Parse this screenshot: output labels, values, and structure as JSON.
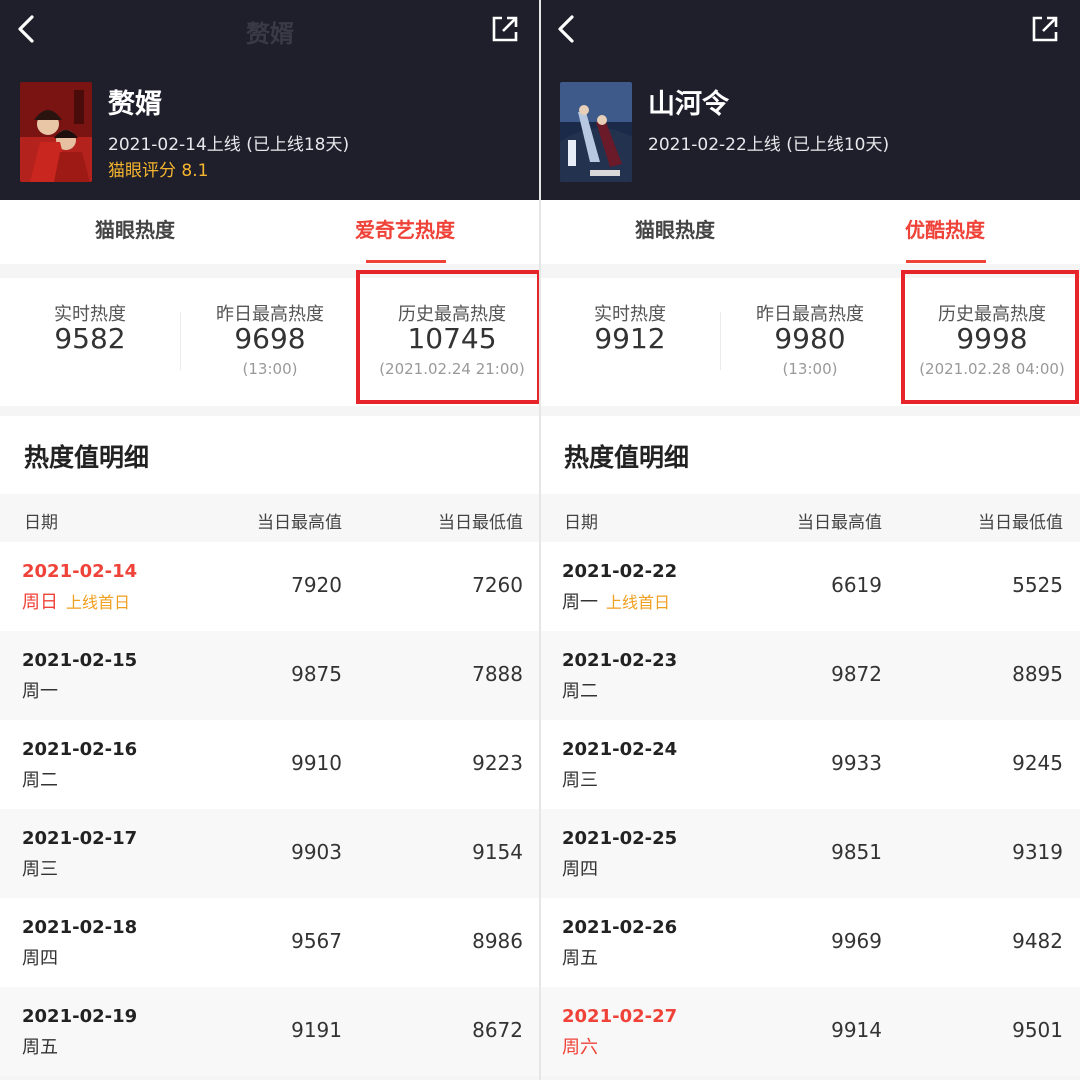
{
  "panels": [
    {
      "nav_title": "赘婿",
      "title": "赘婿",
      "release": "2021-02-14上线 (已上线18天)",
      "rating": "猫眼评分 8.1",
      "poster_icon": "poster-image",
      "tabs": [
        "猫眼热度",
        "爱奇艺热度"
      ],
      "active_tab": 1,
      "stats": {
        "realtime_label": "实时热度",
        "realtime_value": "9582",
        "yesterday_label": "昨日最高热度",
        "yesterday_value": "9698",
        "yesterday_time": "(13:00)",
        "history_label": "历史最高热度",
        "history_value": "10745",
        "history_time": "(2021.02.24 21:00)"
      },
      "section_title": "热度值明细",
      "columns": [
        "日期",
        "当日最高值",
        "当日最低值"
      ],
      "rows": [
        {
          "date": "2021-02-14",
          "weekday": "周日",
          "badge": "上线首日",
          "high": "7920",
          "low": "7260"
        },
        {
          "date": "2021-02-15",
          "weekday": "周一",
          "badge": "",
          "high": "9875",
          "low": "7888"
        },
        {
          "date": "2021-02-16",
          "weekday": "周二",
          "badge": "",
          "high": "9910",
          "low": "9223"
        },
        {
          "date": "2021-02-17",
          "weekday": "周三",
          "badge": "",
          "high": "9903",
          "low": "9154"
        },
        {
          "date": "2021-02-18",
          "weekday": "周四",
          "badge": "",
          "high": "9567",
          "low": "8986"
        },
        {
          "date": "2021-02-19",
          "weekday": "周五",
          "badge": "",
          "high": "9191",
          "low": "8672"
        }
      ]
    },
    {
      "nav_title": "",
      "title": "山河令",
      "release": "2021-02-22上线 (已上线10天)",
      "rating": "",
      "poster_icon": "poster-image",
      "tabs": [
        "猫眼热度",
        "优酷热度"
      ],
      "active_tab": 1,
      "stats": {
        "realtime_label": "实时热度",
        "realtime_value": "9912",
        "yesterday_label": "昨日最高热度",
        "yesterday_value": "9980",
        "yesterday_time": "(13:00)",
        "history_label": "历史最高热度",
        "history_value": "9998",
        "history_time": "(2021.02.28 04:00)"
      },
      "section_title": "热度值明细",
      "columns": [
        "日期",
        "当日最高值",
        "当日最低值"
      ],
      "rows": [
        {
          "date": "2021-02-22",
          "weekday": "周一",
          "badge": "上线首日",
          "high": "6619",
          "low": "5525"
        },
        {
          "date": "2021-02-23",
          "weekday": "周二",
          "badge": "",
          "high": "9872",
          "low": "8895"
        },
        {
          "date": "2021-02-24",
          "weekday": "周三",
          "badge": "",
          "high": "9933",
          "low": "9245"
        },
        {
          "date": "2021-02-25",
          "weekday": "周四",
          "badge": "",
          "high": "9851",
          "low": "9319"
        },
        {
          "date": "2021-02-26",
          "weekday": "周五",
          "badge": "",
          "high": "9969",
          "low": "9482"
        },
        {
          "date": "2021-02-27",
          "weekday": "周六",
          "badge": "",
          "high": "9914",
          "low": "9501"
        }
      ]
    }
  ],
  "colors": {
    "header_bg": "#1f1e2b",
    "accent_red": "#ef4238",
    "highlight_border": "#e8242b",
    "rating_gold": "#f5b52e",
    "badge_orange": "#f0a020"
  },
  "highlighted_rows": {
    "left": [
      0
    ],
    "right": [
      5
    ]
  }
}
